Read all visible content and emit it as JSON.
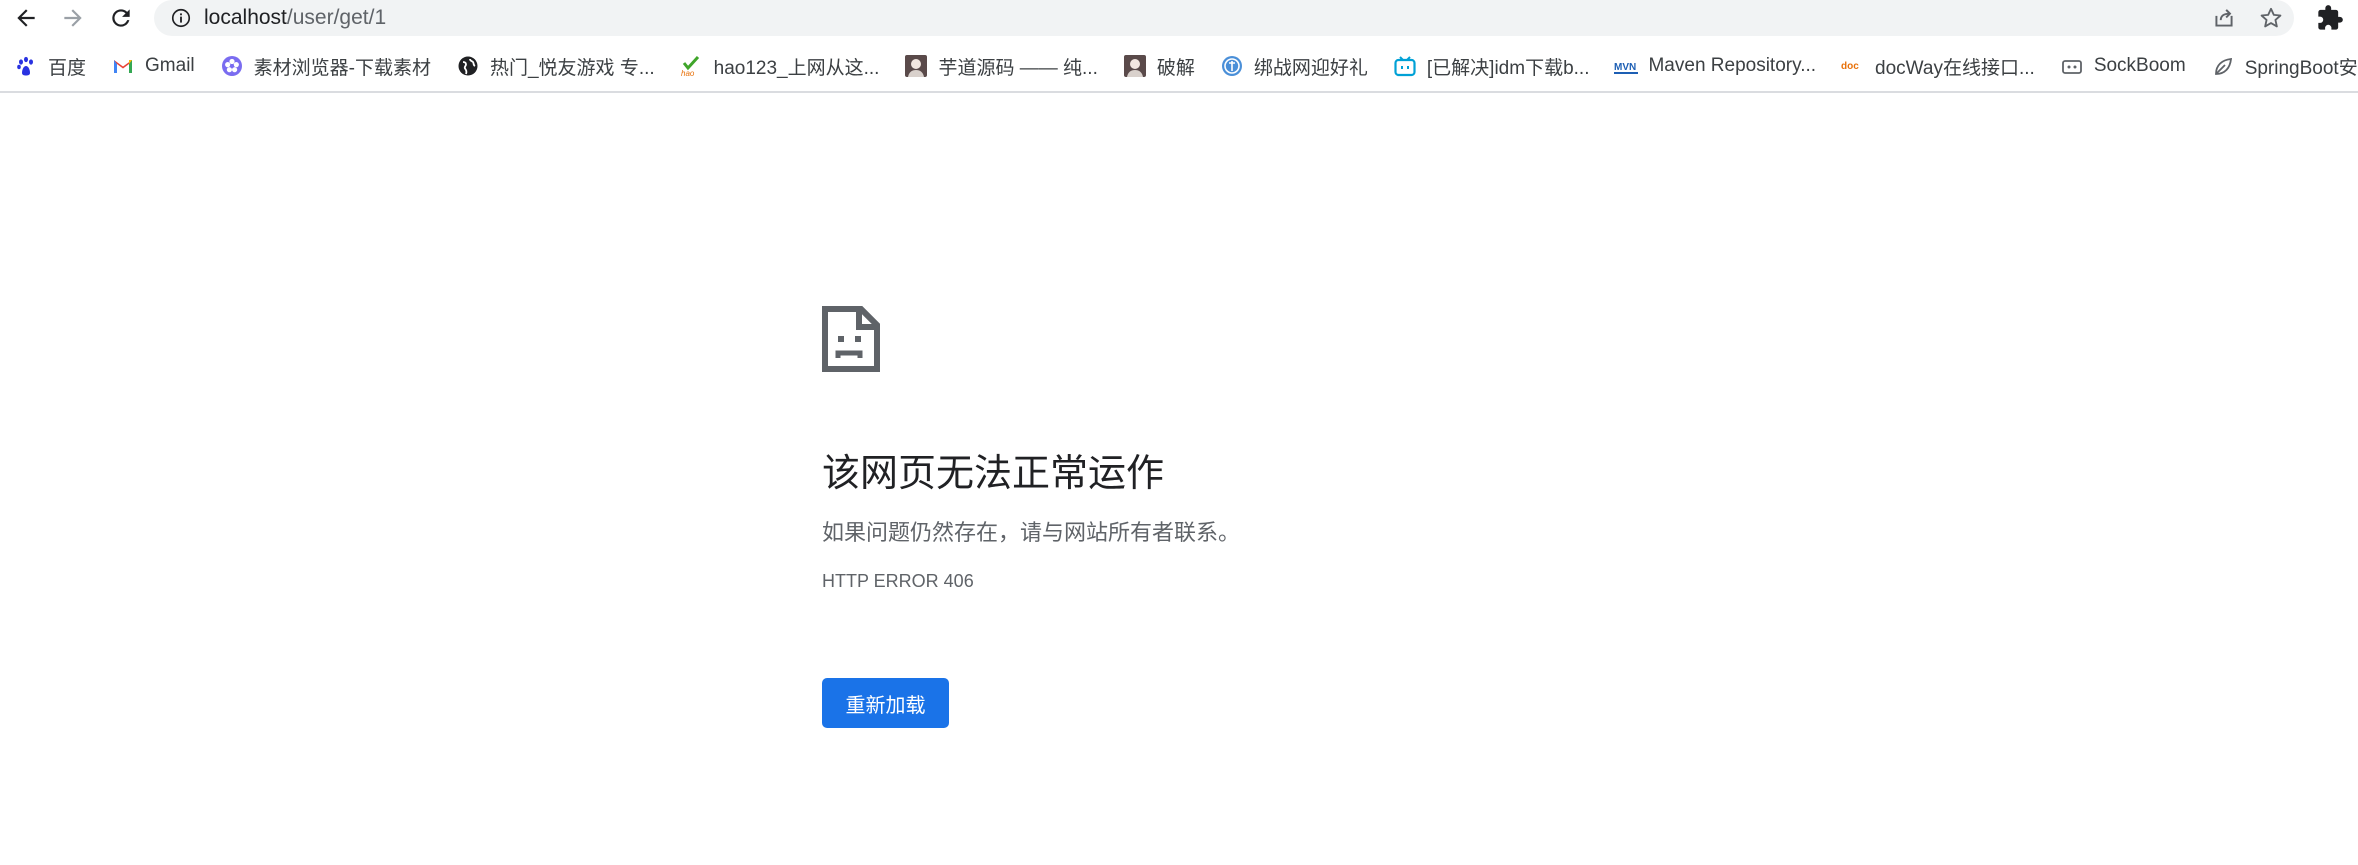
{
  "browser": {
    "address_bar": {
      "host": "localhost",
      "path": "/user/get/1"
    },
    "icons": {
      "back": "arrow-back-icon",
      "forward": "arrow-forward-icon",
      "reload": "reload-icon",
      "site_info": "info-icon",
      "share": "share-icon",
      "bookmark": "star-icon",
      "extensions": "puzzle-icon"
    }
  },
  "bookmarks": [
    {
      "label": "百度",
      "icon": "baidu-paw-icon",
      "color": "#2932e1"
    },
    {
      "label": "Gmail",
      "icon": "gmail-icon",
      "color": "#ea4335"
    },
    {
      "label": "素材浏览器-下载素材",
      "icon": "flower-icon",
      "color": "#7a6cf0"
    },
    {
      "label": "热门_悦友游戏 专...",
      "icon": "globe-icon",
      "color": "#202124"
    },
    {
      "label": "hao123_上网从这...",
      "icon": "hao123-icon",
      "color": "#3fa52a"
    },
    {
      "label": "芋道源码 —— 纯...",
      "icon": "avatar-icon",
      "color": "#5a4a4a"
    },
    {
      "label": "破解",
      "icon": "avatar-icon",
      "color": "#5a4a4a"
    },
    {
      "label": "绑战网迎好礼",
      "icon": "shield-icon",
      "color": "#4a8fd8"
    },
    {
      "label": "[已解决]idm下载b...",
      "icon": "bilibili-tv-icon",
      "color": "#00a1d6"
    },
    {
      "label": "Maven Repository...",
      "icon": "mvn-icon",
      "color": "#1d5fb4"
    },
    {
      "label": "docWay在线接口...",
      "icon": "doc-icon",
      "color": "#e8710a"
    },
    {
      "label": "SockBoom",
      "icon": "cat-icon",
      "color": "#5f6368"
    },
    {
      "label": "SpringBoot安全管",
      "icon": "leaf-icon",
      "color": "#5f6368"
    }
  ],
  "error_page": {
    "icon": "sad-document-icon",
    "title": "该网页无法正常运作",
    "subtitle": "如果问题仍然存在，请与网站所有者联系。",
    "error_code": "HTTP ERROR 406",
    "reload_label": "重新加载",
    "accent_color": "#1a73e8"
  }
}
